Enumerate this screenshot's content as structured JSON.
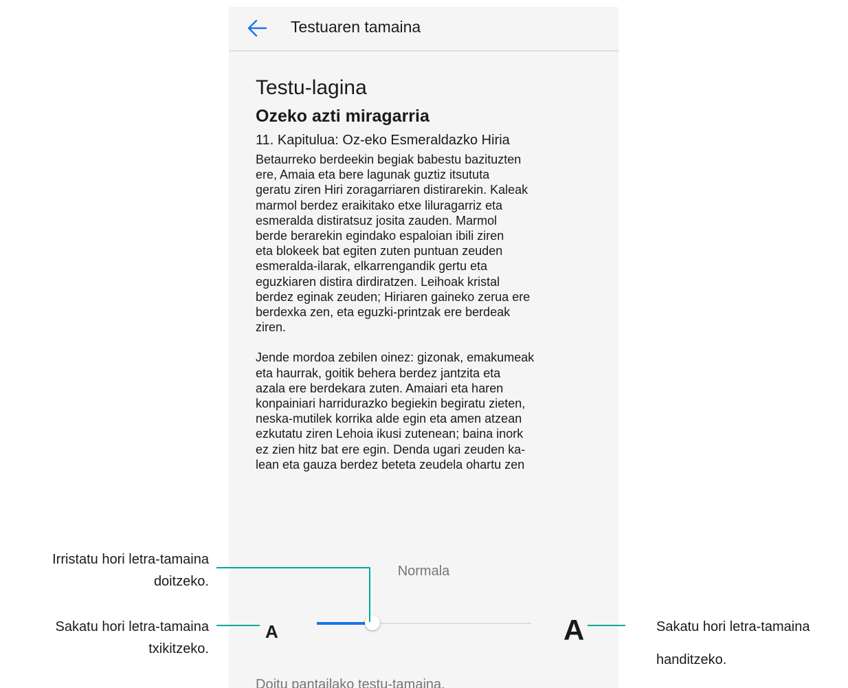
{
  "app_bar": {
    "title": "Testuaren tamaina",
    "back_icon": "arrow-left-icon",
    "accent": "#1a73e8"
  },
  "preview": {
    "heading": "Testu-lagina",
    "book_title": "Ozeko azti miragarria",
    "chapter": "11. Kapitulua: Oz-eko Esmeraldazko Hiria",
    "paragraph1": [
      "Betaurreko berdeekin begiak babestu bazituzten",
      "ere, Amaia eta bere lagunak guztiz itsututa",
      "geratu ziren Hiri zoragarriaren distirarekin. Kaleak",
      "marmol berdez eraikitako etxe liluragarriz eta",
      "esmeralda distiratsuz josita zauden. Marmol",
      "berde berarekin egindako espaloian ibili ziren",
      "eta blokeek bat egiten zuten puntuan zeuden",
      "esmeralda-ilarak, elkarrengandik gertu eta",
      "eguzkiaren distira dirdiratzen. Leihoak kristal",
      "berdez eginak zeuden; Hiriaren gaineko zerua ere",
      "berdexka zen, eta eguzki-printzak ere berdeak",
      "ziren."
    ],
    "paragraph2": [
      "Jende mordoa zebilen oinez: gizonak, emakumeak",
      "eta haurrak, goitik behera berdez jantzita eta",
      "azala ere berdekara zuten. Amaiari eta haren",
      "konpainiari harridurazko begiekin begiratu zieten,",
      "neska-mutilek korrika alde egin eta amen atzean",
      "ezkutatu ziren Lehoia ikusi zutenean; baina inork",
      "ez zien hitz bat ere egin. Denda ugari zeuden ka-",
      "lean eta gauza berdez beteta zeudela ohartu zen"
    ]
  },
  "font_size": {
    "level_label": "Normala",
    "decrease_label": "A",
    "increase_label": "A",
    "slider_value": 0.26,
    "fill_color": "#1a73e8"
  },
  "hint": "Doitu pantailako testu-tamaina.",
  "callouts": {
    "slider": [
      "Irristatu hori letra-tamaina",
      "doitzeko."
    ],
    "decrease": [
      "Sakatu hori letra-tamaina",
      "txikitzeko."
    ],
    "increase": [
      "Sakatu hori letra-tamaina",
      "handitzeko."
    ],
    "line_color": "#00a99d"
  }
}
